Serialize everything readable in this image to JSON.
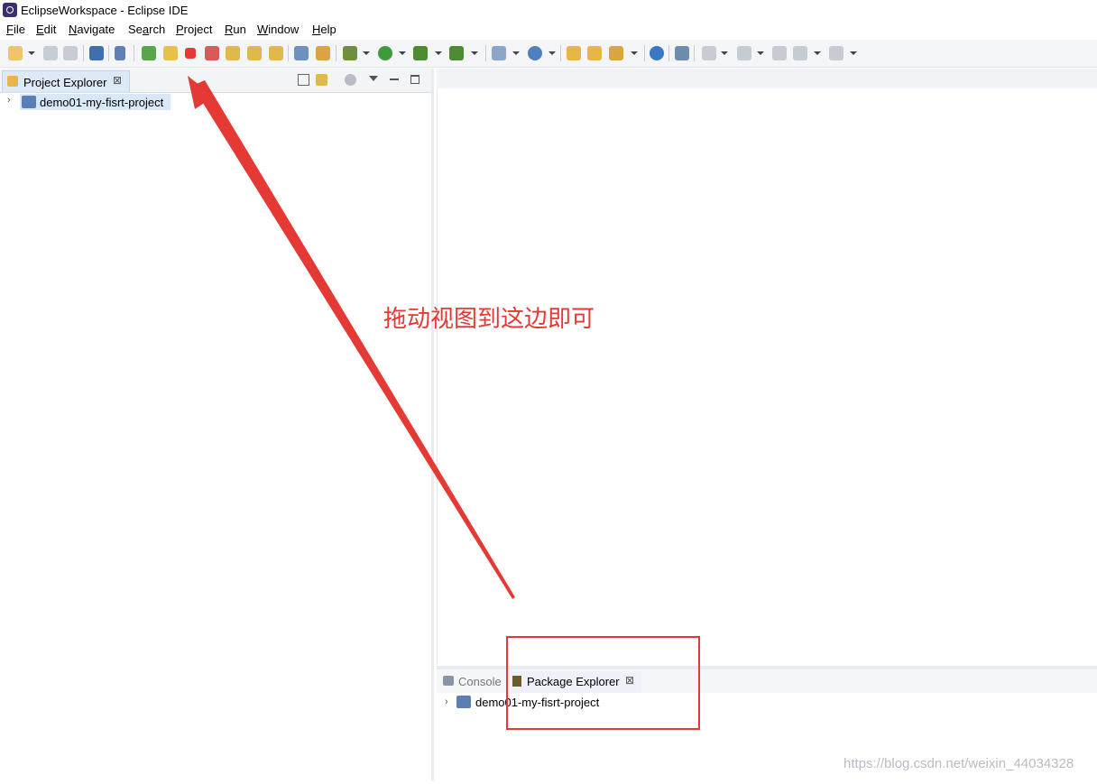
{
  "window": {
    "title": "EclipseWorkspace - Eclipse IDE"
  },
  "menu": [
    {
      "mnemonic": "F",
      "rest": "ile"
    },
    {
      "mnemonic": "E",
      "rest": "dit"
    },
    {
      "mnemonic": "N",
      "rest": "avigate"
    },
    {
      "mnemonic": "",
      "pre": "Se",
      "mnemonic2": "a",
      "rest": "rch"
    },
    {
      "mnemonic": "P",
      "rest": "roject"
    },
    {
      "mnemonic": "R",
      "rest": "un"
    },
    {
      "mnemonic": "W",
      "rest": "indow"
    },
    {
      "mnemonic": "H",
      "rest": "elp"
    }
  ],
  "left_view": {
    "tab_label": "Project Explorer",
    "close_glyph": "⊠",
    "tree_item": "demo01-my-fisrt-project"
  },
  "bottom_view": {
    "console_label": "Console",
    "package_label": "Package Explorer",
    "close_glyph": "⊠",
    "tree_item": "demo01-my-fisrt-project"
  },
  "annotation": {
    "text": "拖动视图到这边即可",
    "color": "#e53935"
  },
  "watermark": "https://blog.csdn.net/weixin_44034328",
  "icons": [
    "new-icon",
    "save-icon",
    "save-all-icon",
    "console-icon",
    "skip-breakpoints-icon",
    "resume-icon",
    "suspend-icon",
    "terminate-icon",
    "disconnect-icon",
    "step-into-icon",
    "step-over-icon",
    "step-return-icon",
    "use-step-filters-icon",
    "drop-to-frame-icon",
    "debug-icon",
    "run-icon",
    "coverage-icon",
    "external-tools-icon",
    "new-java-project-icon",
    "new-class-icon",
    "open-type-icon",
    "open-task-icon",
    "search-icon",
    "web-browser-icon",
    "remote-icon",
    "next-annotation-icon",
    "previous-annotation-icon",
    "last-edit-icon",
    "back-icon",
    "forward-icon"
  ]
}
